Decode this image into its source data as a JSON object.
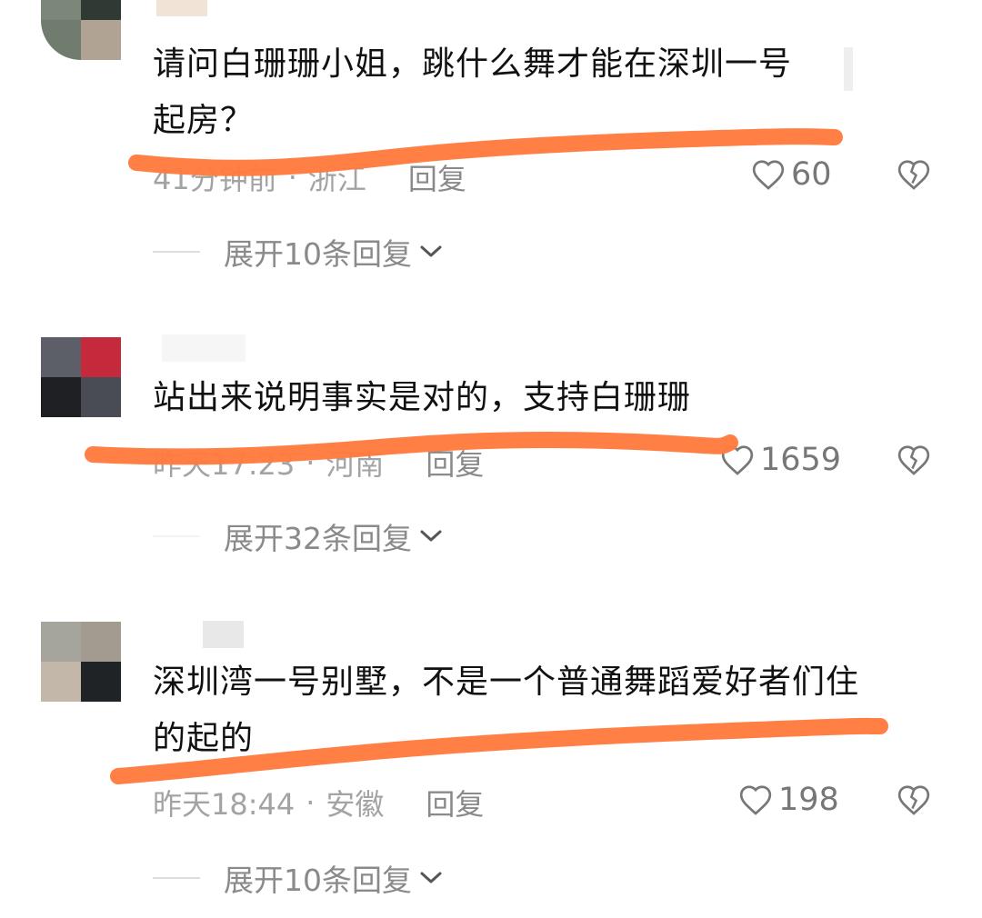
{
  "comments": [
    {
      "text_lines": [
        "请问白珊珊小姐，跳什么舞才能在深圳一号",
        "起房？"
      ],
      "time": "41分钟前",
      "location": "浙江",
      "reply_label": "回复",
      "likes": "60",
      "expand_label": "展开10条回复"
    },
    {
      "text_lines": [
        "站出来说明事实是对的，支持白珊珊"
      ],
      "time": "昨天17:23",
      "location": "河南",
      "reply_label": "回复",
      "likes": "1659",
      "expand_label": "展开32条回复"
    },
    {
      "text_lines": [
        "深圳湾一号别墅，不是一个普通舞蹈爱好者们住",
        "的起的"
      ],
      "time": "昨天18:44",
      "location": "安徽",
      "reply_label": "回复",
      "likes": "198",
      "expand_label": "展开10条回复"
    }
  ],
  "separator": "·",
  "colors": {
    "highlight_stroke": "#ff7a3d",
    "text": "#111111",
    "meta": "#a3a3a3",
    "icon": "#777777"
  },
  "icons": {
    "like": "heart-outline-icon",
    "dislike": "broken-heart-icon",
    "expand": "chevron-down-icon"
  }
}
